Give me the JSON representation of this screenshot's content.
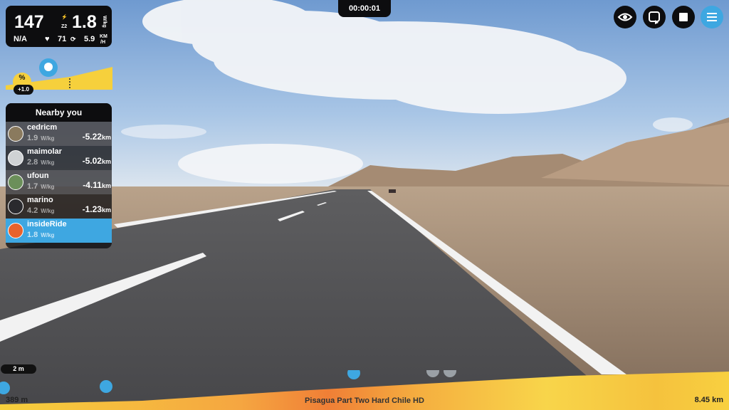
{
  "metrics": {
    "power": "147",
    "zone_icon": "lightning-icon",
    "zone": "Z2",
    "wkg": "1.8",
    "wkg_unit": "W/kg",
    "heart_rate": "N/A",
    "cadence": "71",
    "speed": "5.9",
    "speed_unit_top": "KM",
    "speed_unit_bottom": "/H"
  },
  "gradient": {
    "symbol": "%",
    "value": "+1.0"
  },
  "timer": "00:00:01",
  "nearby": {
    "title": "Nearby you",
    "riders": [
      {
        "name": "cedricm",
        "wkg": "1.9",
        "unit": "W/kg",
        "distance": "-5.22",
        "dist_unit": "km"
      },
      {
        "name": "maimolar",
        "wkg": "2.8",
        "unit": "W/kg",
        "distance": "-5.02",
        "dist_unit": "km"
      },
      {
        "name": "ufoun",
        "wkg": "1.7",
        "unit": "W/kg",
        "distance": "-4.11",
        "dist_unit": "km"
      },
      {
        "name": "marino",
        "wkg": "4.2",
        "unit": "W/kg",
        "distance": "-1.23",
        "dist_unit": "km"
      },
      {
        "name": "insideRide",
        "wkg": "1.8",
        "unit": "W/kg",
        "distance": "",
        "dist_unit": ""
      }
    ]
  },
  "toolbar": {
    "buttons": [
      "eye-icon",
      "repeat-icon",
      "stop-icon",
      "menu-icon"
    ]
  },
  "route": {
    "name": "Pisagua Part Two Hard Chile HD",
    "distance_done": "389 m",
    "distance_total": "8.45 km",
    "scale": "2 m"
  },
  "colors": {
    "accent": "#3ea7e1",
    "hud": "#0d0d0f",
    "elevation": "#f6d03c"
  }
}
